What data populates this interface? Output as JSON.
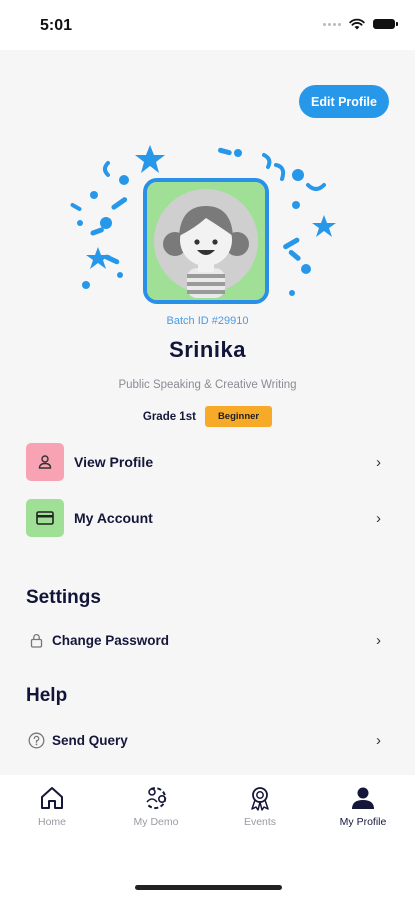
{
  "status_bar": {
    "time": "5:01"
  },
  "header": {
    "edit_profile_label": "Edit Profile"
  },
  "profile": {
    "batch_id": "Batch ID #29910",
    "name": "Srinika",
    "courses": "Public Speaking & Creative Writing",
    "grade": "Grade 1st",
    "level": "Beginner"
  },
  "menu": [
    {
      "label": "View Profile",
      "icon": "user-icon",
      "color": "#f7a3b3"
    },
    {
      "label": "My Account",
      "icon": "card-icon",
      "color": "#9fe096"
    }
  ],
  "settings": {
    "title": "Settings",
    "items": [
      {
        "label": "Change Password",
        "icon": "lock-icon"
      }
    ]
  },
  "help": {
    "title": "Help",
    "items": [
      {
        "label": "Send Query",
        "icon": "question-icon"
      }
    ]
  },
  "tabbar": {
    "tabs": [
      {
        "label": "Home",
        "icon": "home-icon"
      },
      {
        "label": "My Demo",
        "icon": "demo-icon"
      },
      {
        "label": "Events",
        "icon": "award-icon"
      },
      {
        "label": "My Profile",
        "icon": "person-icon",
        "active": true
      }
    ]
  },
  "colors": {
    "accent": "#2797e9",
    "beginner": "#f7a928",
    "avatar_bg": "#9fe096"
  }
}
